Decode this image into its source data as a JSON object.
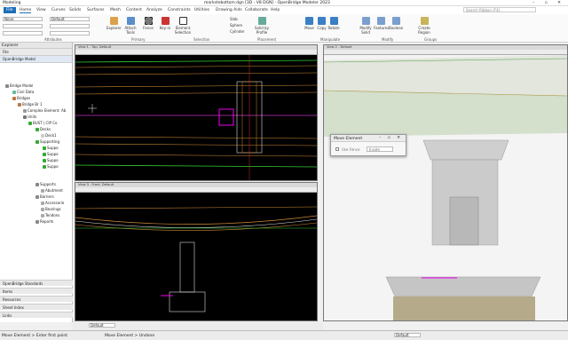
{
  "window": {
    "title": "Modeling",
    "filename": "markstebottom.dgn [3D - V8 DGN] - OpenBridge Modeler 2023",
    "search_placeholder": "Search Ribbon (F4)"
  },
  "menu": [
    "File",
    "Home",
    "View",
    "Curves",
    "Solids",
    "Surfaces",
    "Mesh",
    "Content",
    "Analyze",
    "Constraints",
    "Utilities",
    "Drawing Aids",
    "Collaborate",
    "Help"
  ],
  "ribbon": {
    "level": "None",
    "style": "Default",
    "groups": [
      "Attributes",
      "Primary",
      "Selection",
      "Placement",
      "Manipulate",
      "Modify",
      "Groups"
    ],
    "buttons": {
      "explorer": "Explorer",
      "attach": "Attach Tools",
      "fence": "Fence",
      "keyset": "Key-in",
      "element_selection": "Element Selection",
      "slab": "Slab",
      "sphere": "Sphere",
      "cylinder": "Cylinder",
      "solid_by_profile": "Solid by Profile",
      "move": "Move",
      "copy": "Copy",
      "rotate": "Rotate",
      "modify_solid": "Modify Solid",
      "features": "Features",
      "boolean": "Boolean",
      "create_region": "Create Region"
    }
  },
  "explorer": {
    "title": "Explorer",
    "tab": "File",
    "model_tab": "OpenBridge Model",
    "tree": [
      "Bridge Model",
      "Civil Data",
      "Bridges",
      "Bridge Br 1",
      "Complex Element: Ab",
      "Units",
      "BUST | CIP Co",
      "Decks",
      "Deck1",
      "Supporting",
      "Suppo",
      "Suppo",
      "Suppo",
      "Suppo",
      "Supports",
      "Abutment",
      "Barriers",
      "Accessorie",
      "Bearings",
      "Tendons",
      "Reports"
    ],
    "sections": [
      "OpenBridge Standards",
      "Items",
      "Resources",
      "Sheet Index",
      "Links"
    ]
  },
  "views": {
    "v1": "View 1 - Top, Default",
    "v2": "View 2 - Default",
    "v3": "View 3 - Front, Default"
  },
  "dialog": {
    "title": "Move Element",
    "checkbox_label": "Use Fence",
    "select_value": "Inside"
  },
  "status": {
    "left": "Move Element > Enter first point",
    "middle": "Move Element > Undone",
    "level_default": "Default",
    "default2": "Default"
  }
}
